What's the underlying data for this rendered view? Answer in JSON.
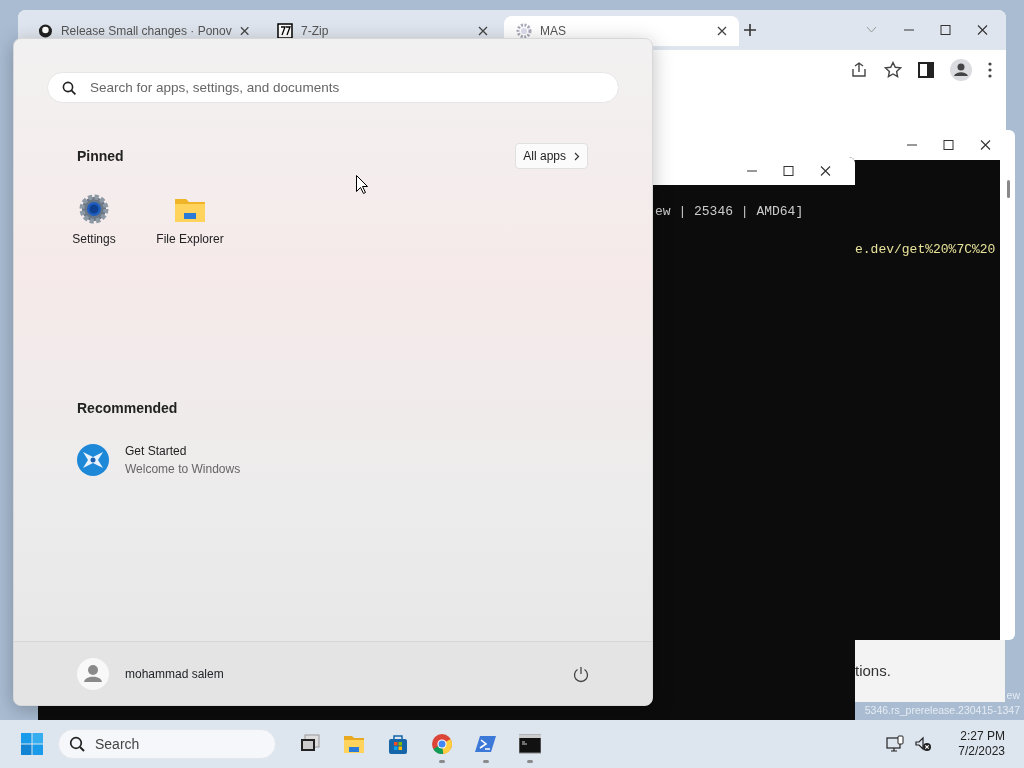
{
  "browser": {
    "tabs": [
      {
        "title": "Release Small changes · Ponov",
        "kind": "github",
        "selected": false
      },
      {
        "title": "7-Zip",
        "kind": "sevenzip",
        "selected": false
      },
      {
        "title": "MAS",
        "kind": "gear",
        "selected": true
      }
    ]
  },
  "console_back": {
    "lines": [
      "e.dev/get%20%7C%20"
    ]
  },
  "console_front": {
    "lines": [
      "ew | 25346 | AMD64]"
    ]
  },
  "dialog": {
    "text": "tions."
  },
  "desktop_watermark": {
    "lines": [
      "ew",
      "5346.rs_prerelease.230415-1347"
    ]
  },
  "start_menu": {
    "search": {
      "placeholder": "Search for apps, settings, and documents"
    },
    "pinned": {
      "title": "Pinned",
      "all_apps": "All apps",
      "apps": [
        {
          "label": "Settings",
          "kind": "settings"
        },
        {
          "label": "File Explorer",
          "kind": "folder"
        }
      ]
    },
    "recommended": {
      "title": "Recommended",
      "items": [
        {
          "title": "Get Started",
          "subtitle": "Welcome to Windows"
        }
      ]
    },
    "user": {
      "name": "mohammad salem"
    }
  },
  "taskbar": {
    "search": "Search",
    "apps": [
      {
        "kind": "taskview",
        "running": false
      },
      {
        "kind": "folder",
        "running": false
      },
      {
        "kind": "store",
        "running": false
      },
      {
        "kind": "chrome",
        "running": true
      },
      {
        "kind": "powershell",
        "running": true
      },
      {
        "kind": "cmd",
        "running": true
      }
    ],
    "time": "2:27 PM",
    "date": "7/2/2023"
  }
}
